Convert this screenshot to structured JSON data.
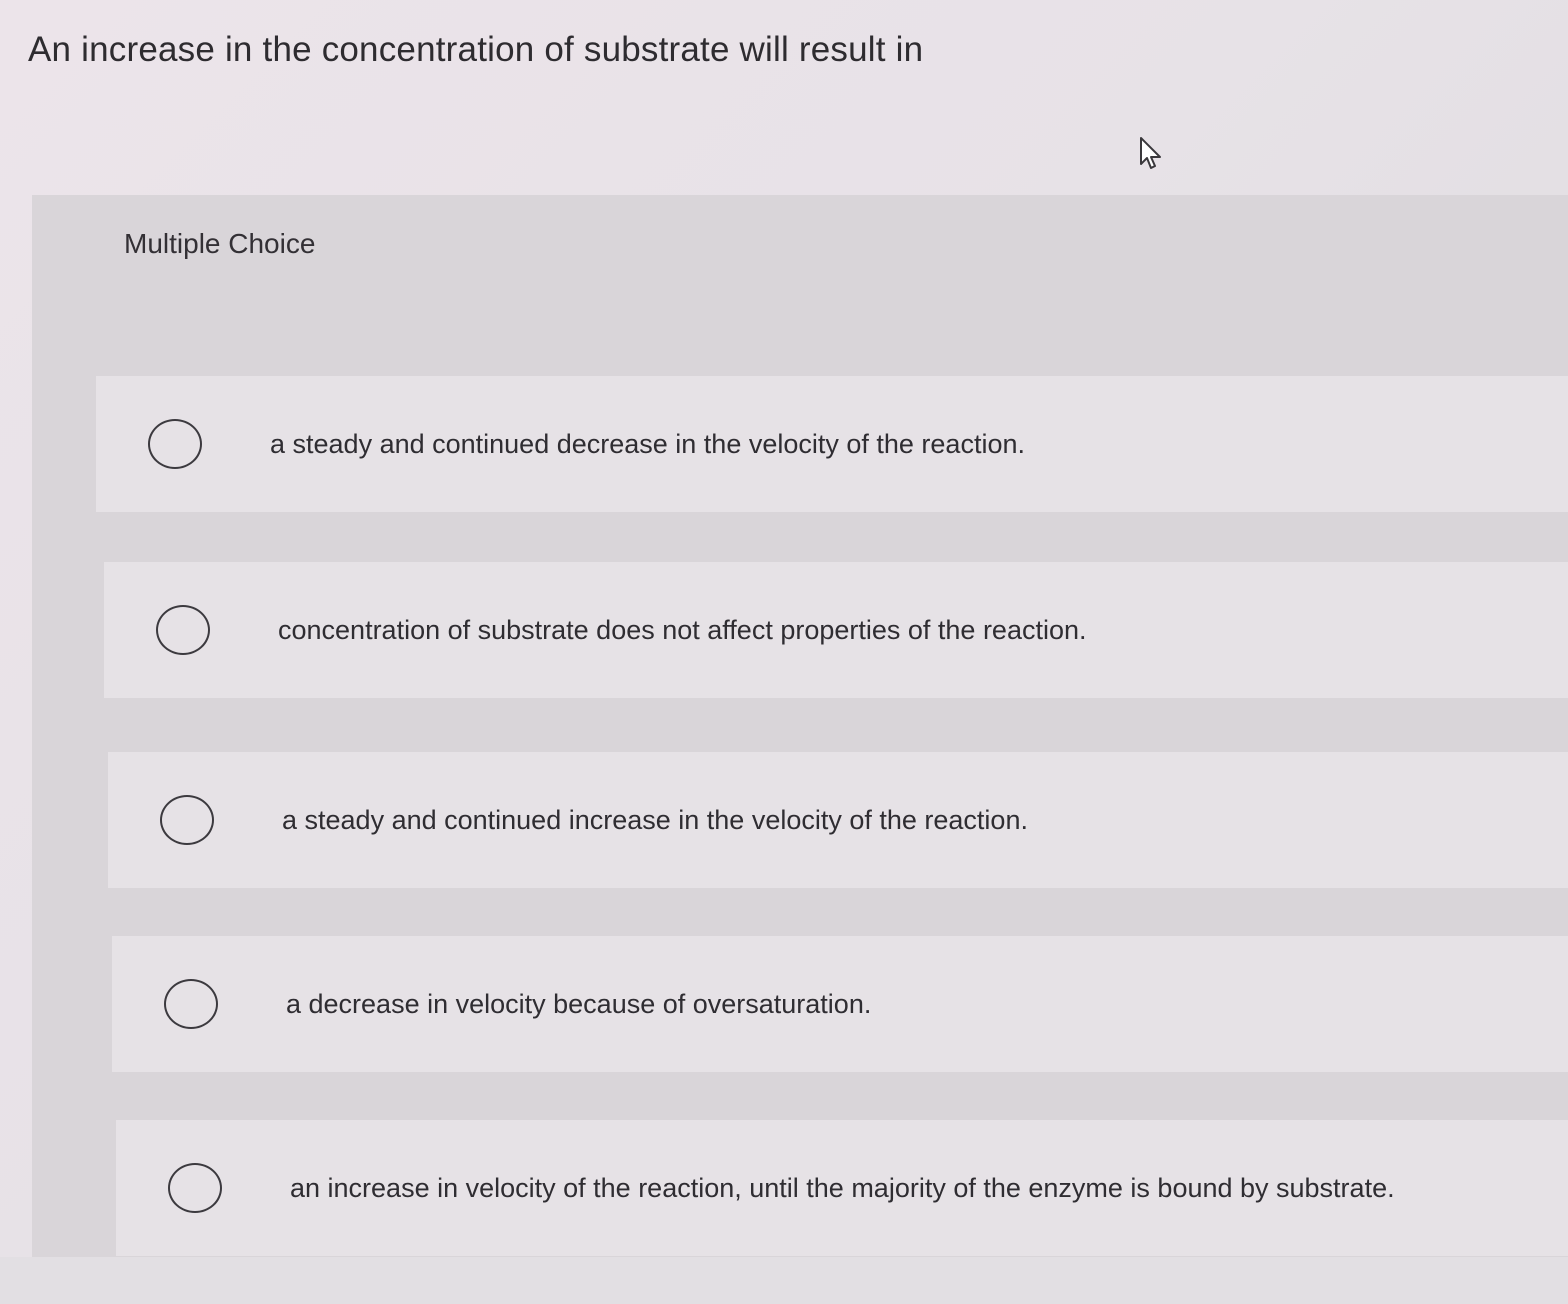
{
  "question": {
    "text": "An increase in the concentration of substrate will result in"
  },
  "multiple_choice": {
    "label": "Multiple Choice",
    "options": [
      {
        "text": "a steady and continued decrease in the velocity of the reaction.",
        "selected": false
      },
      {
        "text": "concentration of substrate does not affect properties of the reaction.",
        "selected": false
      },
      {
        "text": "a steady and continued increase in the velocity of the reaction.",
        "selected": false
      },
      {
        "text": "a decrease in velocity because of oversaturation.",
        "selected": false
      },
      {
        "text": "an increase in velocity of the reaction, until the majority of the enzyme is bound by substrate.",
        "selected": false
      }
    ]
  },
  "cursor": {
    "icon": "pointer-arrow-icon"
  }
}
